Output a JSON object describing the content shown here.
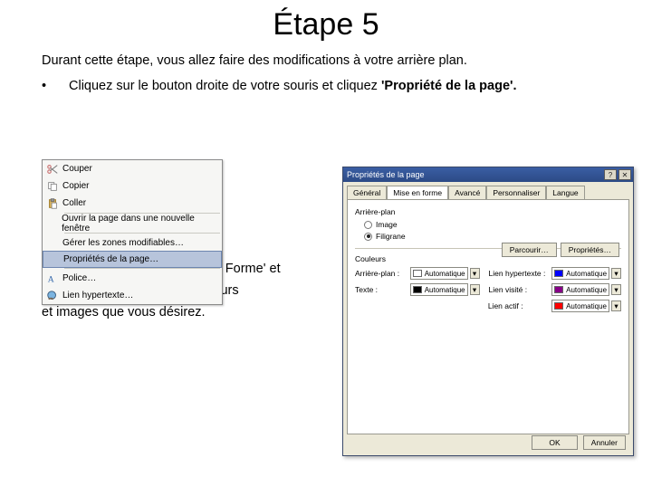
{
  "title": "Étape 5",
  "intro": "Durant cette étape, vous allez faire des modifications à votre arrière plan.",
  "bullet1_pre": "Cliquez sur le bouton droite de votre souris et cliquez ",
  "bullet1_bold": "'Propriété de la page'.",
  "bullet2": "Après cliquez sur 'Mise en Forme' et",
  "after1": "faite les modifications de couleurs",
  "after2": "et images que vous désirez.",
  "ctx": {
    "cut": "Couper",
    "copy": "Copier",
    "paste": "Coller",
    "open_new": "Ouvrir la page dans une nouvelle fenêtre",
    "manage": "Gérer les zones modifiables…",
    "page_props": "Propriétés de la page…",
    "font": "Police…",
    "hyperlink": "Lien hypertexte…"
  },
  "dlg": {
    "title": "Propriétés de la page",
    "tabs": {
      "general": "Général",
      "format": "Mise en forme",
      "advanced": "Avancé",
      "custom": "Personnaliser",
      "lang": "Langue"
    },
    "bg_label": "Arrière-plan",
    "r_image": "Image",
    "r_filigrane": "Filigrane",
    "browse": "Parcourir…",
    "props": "Propriétés…",
    "colors_label": "Couleurs",
    "row_bg": "Arrière-plan :",
    "row_text": "Texte :",
    "row_hyper": "Lien hypertexte :",
    "row_visited": "Lien visité :",
    "row_hover": "Lien actif :",
    "auto": "Automatique",
    "ok": "OK",
    "cancel": "Annuler"
  }
}
